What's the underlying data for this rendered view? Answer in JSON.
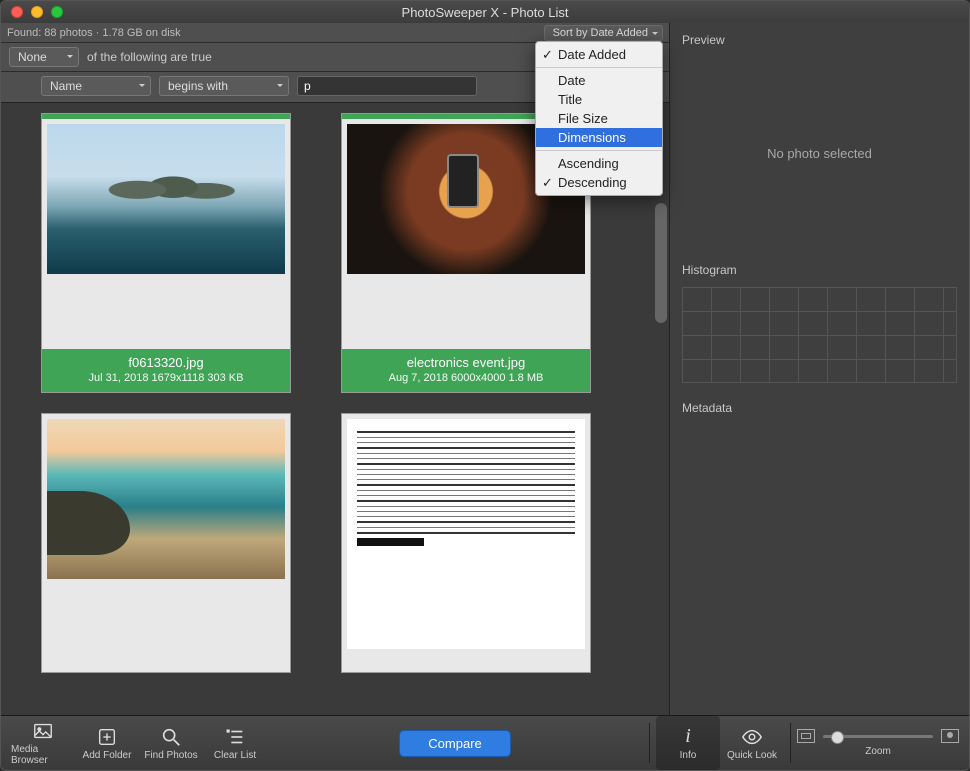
{
  "window": {
    "title": "PhotoSweeper X - Photo List"
  },
  "status": {
    "found": "Found: 88 photos · 1.78 GB on disk"
  },
  "sort": {
    "button_label": "Sort by Date Added",
    "menu": {
      "date_added": "Date Added",
      "date": "Date",
      "title": "Title",
      "file_size": "File Size",
      "dimensions": "Dimensions",
      "ascending": "Ascending",
      "descending": "Descending"
    }
  },
  "filter": {
    "match_mode": "None",
    "match_text": "of the following are true",
    "field": "Name",
    "op": "begins with",
    "value": "p"
  },
  "photos": [
    {
      "filename": "f0613320.jpg",
      "meta": "Jul 31, 2018   1679x1118   303 KB"
    },
    {
      "filename": "electronics event.jpg",
      "meta": "Aug 7, 2018   6000x4000   1.8 MB"
    }
  ],
  "side": {
    "preview_hdr": "Preview",
    "preview_placeholder": "No photo selected",
    "histogram_hdr": "Histogram",
    "metadata_hdr": "Metadata"
  },
  "toolbar": {
    "media_browser": "Media Browser",
    "add_folder": "Add Folder",
    "find_photos": "Find Photos",
    "clear_list": "Clear List",
    "compare": "Compare",
    "info": "Info",
    "quick_look": "Quick Look",
    "zoom": "Zoom"
  }
}
